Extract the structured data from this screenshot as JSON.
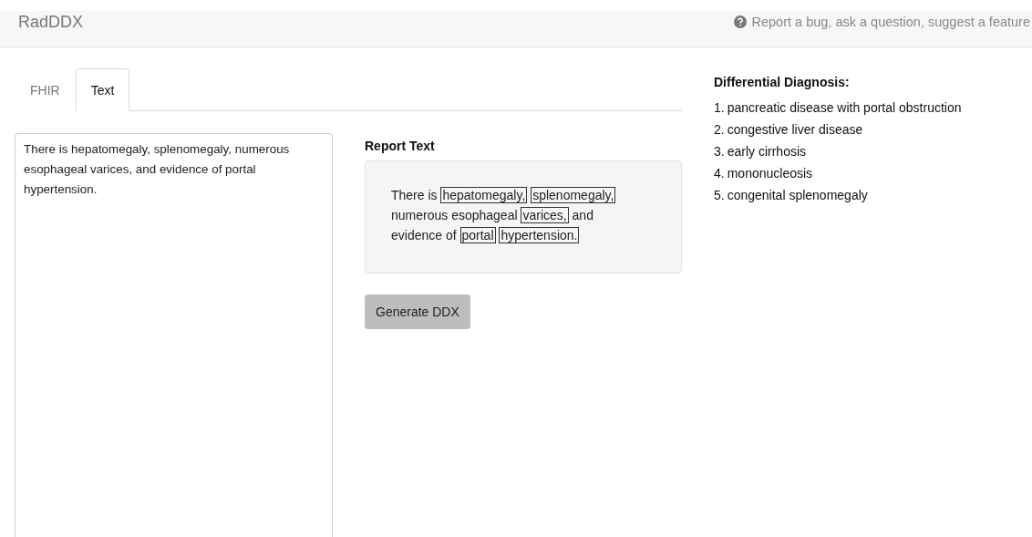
{
  "navbar": {
    "brand": "RadDDX",
    "help_link": "Report a bug, ask a question, suggest a feature"
  },
  "tabs": [
    {
      "label": "FHIR",
      "selected": false
    },
    {
      "label": "Text",
      "selected": true
    }
  ],
  "input_text": {
    "value": "There is hepatomegaly, splenomegaly, numerous esophageal varices, and evidence of portal hypertension."
  },
  "report": {
    "heading": "Report Text",
    "segments": [
      {
        "text": "There is ",
        "highlighted": false
      },
      {
        "text": "hepatomegaly,",
        "highlighted": true
      },
      {
        "text": "splenomegaly,",
        "highlighted": true
      },
      {
        "text": " numerous esophageal ",
        "highlighted": false
      },
      {
        "text": "varices,",
        "highlighted": true
      },
      {
        "text": " and evidence of ",
        "highlighted": false
      },
      {
        "text": "portal",
        "highlighted": true
      },
      {
        "text": "hypertension.",
        "highlighted": true
      }
    ]
  },
  "generate_button": {
    "label": "Generate DDX"
  },
  "differential": {
    "heading": "Differential Diagnosis:",
    "items": [
      {
        "number": "1.",
        "text": "pancreatic disease with portal obstruction"
      },
      {
        "number": "2.",
        "text": "congestive liver disease"
      },
      {
        "number": "3.",
        "text": "early cirrhosis"
      },
      {
        "number": "4.",
        "text": "mononucleosis"
      },
      {
        "number": "5.",
        "text": "congenital splenomegaly"
      }
    ]
  }
}
